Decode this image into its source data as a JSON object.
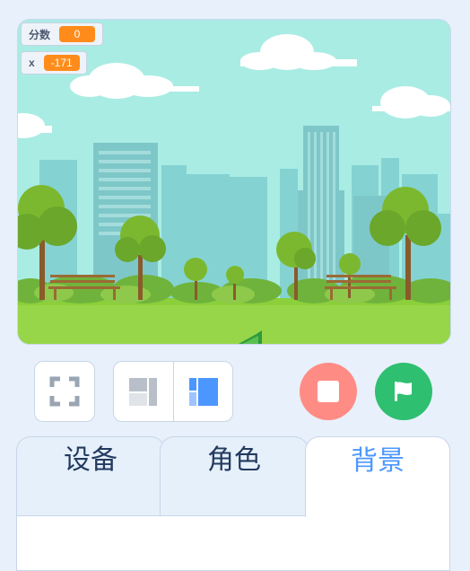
{
  "monitors": [
    {
      "label": "分数",
      "value": "0"
    },
    {
      "label": "x",
      "value": "-171"
    }
  ],
  "controls": {
    "fullscreen": "fullscreen-icon",
    "small_stage": "small-stage-icon",
    "large_stage": "large-stage-icon",
    "stop": "stop-icon",
    "green_flag": "green-flag-icon"
  },
  "tabs": [
    {
      "label": "设备",
      "active": false
    },
    {
      "label": "角色",
      "active": false
    },
    {
      "label": "背景",
      "active": true
    }
  ],
  "colors": {
    "accent": "#4c97ff",
    "stop": "#ff8c84",
    "go": "#2fbf71",
    "monitor_value": "#ff8c1a"
  }
}
